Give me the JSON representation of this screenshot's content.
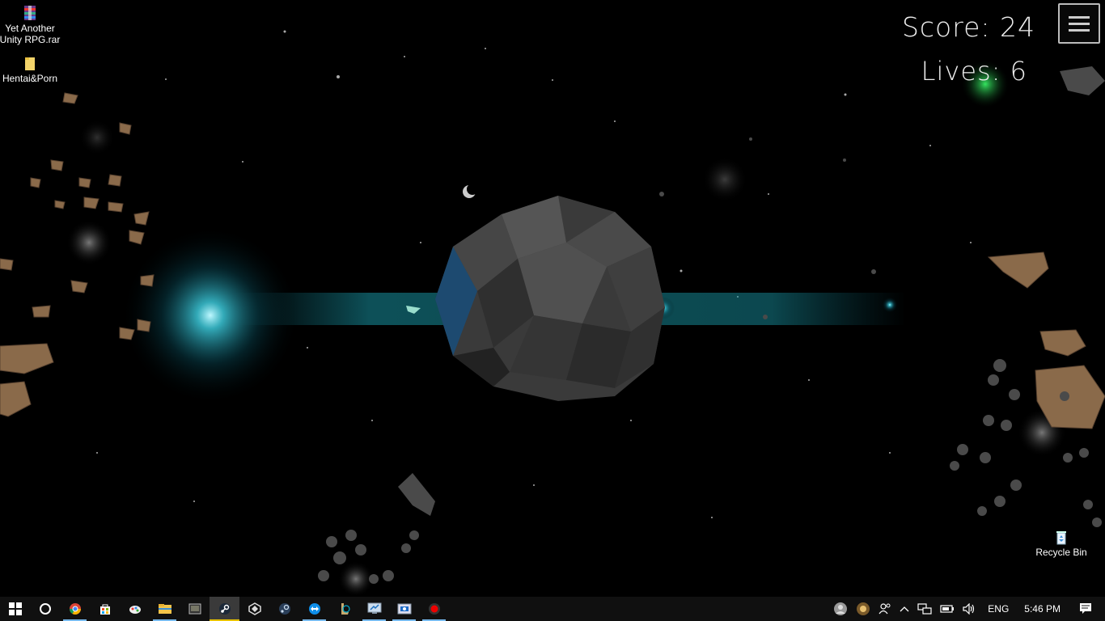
{
  "hud": {
    "score_label": "Score: 24",
    "lives_label": "Lives: 6",
    "menu_icon": "hamburger-menu-icon"
  },
  "desktop": {
    "icons": [
      {
        "label_line1": "Yet Another",
        "label_line2": "Unity RPG.rar",
        "icon": "winrar-archive-icon"
      },
      {
        "label": "Hentai&Porn",
        "icon": "folder-icon"
      },
      {
        "label": "Recycle Bin",
        "icon": "recycle-bin-icon"
      }
    ]
  },
  "taskbar": {
    "apps": [
      {
        "icon": "windows-start-icon"
      },
      {
        "icon": "cortana-search-icon"
      },
      {
        "icon": "chrome-icon",
        "active": true
      },
      {
        "icon": "store-icon"
      },
      {
        "icon": "paint-icon"
      },
      {
        "icon": "file-explorer-icon",
        "active": true
      },
      {
        "icon": "media-player-icon"
      },
      {
        "icon": "steam-icon",
        "highlight": true
      },
      {
        "icon": "unity-icon"
      },
      {
        "icon": "steam-client-icon"
      },
      {
        "icon": "teamviewer-icon",
        "active": true
      },
      {
        "icon": "league-icon"
      },
      {
        "icon": "remote-desktop-icon",
        "active": true
      },
      {
        "icon": "vmware-icon",
        "active": true
      },
      {
        "icon": "record-icon",
        "active": true
      }
    ],
    "tray": {
      "language": "ENG",
      "time": "5:46 PM"
    }
  },
  "colors": {
    "accent": "#76b9ed",
    "glow": "#1ec8d8",
    "rock": "#8a6a4a"
  }
}
